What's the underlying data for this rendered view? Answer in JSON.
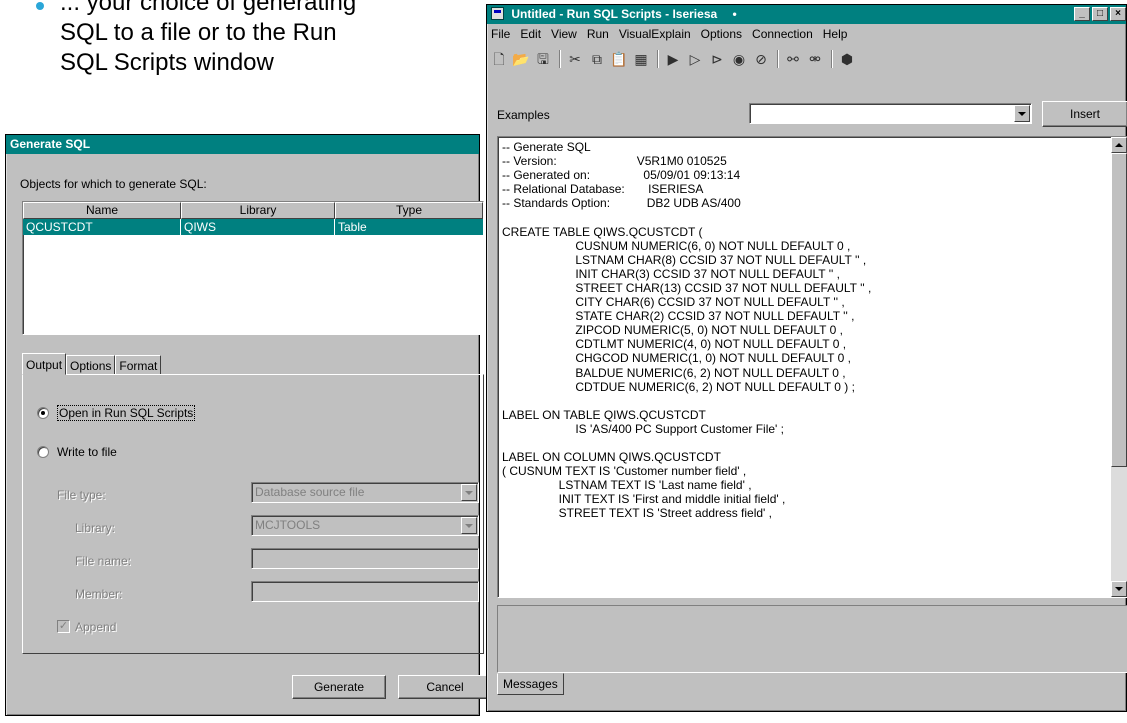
{
  "slide": {
    "lines": [
      "... your choice of generating",
      "SQL to a file or to the Run",
      "SQL Scripts window"
    ]
  },
  "generate_dialog": {
    "title": "Generate SQL",
    "objects_label": "Objects for which to generate SQL:",
    "columns": [
      "Name",
      "Library",
      "Type"
    ],
    "rows": [
      {
        "name": "QCUSTCDT",
        "library": "QIWS",
        "type": "Table"
      }
    ],
    "tabs": [
      "Output",
      "Options",
      "Format"
    ],
    "output": {
      "open_in_run_sql": "Open in Run SQL Scripts",
      "write_to_file": "Write to file",
      "selected": "open_in_run_sql",
      "file_type_label": "File type:",
      "file_type_value": "Database source file",
      "library_label": "Library:",
      "library_value": "MCJTOOLS",
      "file_name_label": "File name:",
      "file_name_value": "",
      "member_label": "Member:",
      "member_value": "",
      "append_label": "Append",
      "append_checked": true
    },
    "buttons": {
      "generate": "Generate",
      "cancel": "Cancel"
    }
  },
  "run_window": {
    "title": "Untitled - Run SQL Scripts - Iseriesa",
    "title_marker": "•",
    "menu": [
      "File",
      "Edit",
      "View",
      "Run",
      "VisualExplain",
      "Options",
      "Connection",
      "Help"
    ],
    "examples_label": "Examples",
    "examples_value": "",
    "insert_button": "Insert",
    "sql_lines": [
      "-- Generate SQL",
      "-- Version:                        V5R1M0 010525",
      "-- Generated on:                05/09/01 09:13:14",
      "-- Relational Database:       ISERIESA",
      "-- Standards Option:           DB2 UDB AS/400",
      "",
      "CREATE TABLE QIWS.QCUSTCDT (",
      "                      CUSNUM NUMERIC(6, 0) NOT NULL DEFAULT 0 ,",
      "                      LSTNAM CHAR(8) CCSID 37 NOT NULL DEFAULT '' ,",
      "                      INIT CHAR(3) CCSID 37 NOT NULL DEFAULT '' ,",
      "                      STREET CHAR(13) CCSID 37 NOT NULL DEFAULT '' ,",
      "                      CITY CHAR(6) CCSID 37 NOT NULL DEFAULT '' ,",
      "                      STATE CHAR(2) CCSID 37 NOT NULL DEFAULT '' ,",
      "                      ZIPCOD NUMERIC(5, 0) NOT NULL DEFAULT 0 ,",
      "                      CDTLMT NUMERIC(4, 0) NOT NULL DEFAULT 0 ,",
      "                      CHGCOD NUMERIC(1, 0) NOT NULL DEFAULT 0 ,",
      "                      BALDUE NUMERIC(6, 2) NOT NULL DEFAULT 0 ,",
      "                      CDTDUE NUMERIC(6, 2) NOT NULL DEFAULT 0 ) ;",
      "",
      "LABEL ON TABLE QIWS.QCUSTCDT",
      "                      IS 'AS/400 PC Support Customer File' ;",
      "",
      "LABEL ON COLUMN QIWS.QCUSTCDT",
      "( CUSNUM TEXT IS 'Customer number field' ,",
      "                 LSTNAM TEXT IS 'Last name field' ,",
      "                 INIT TEXT IS 'First and middle initial field' ,",
      "                 STREET TEXT IS 'Street address field' ,"
    ],
    "messages_tab": "Messages"
  },
  "colors": {
    "titlebar": "#008080",
    "selection": "#008080",
    "face": "#c0c0c0",
    "bullet": "#2aa6d8"
  }
}
